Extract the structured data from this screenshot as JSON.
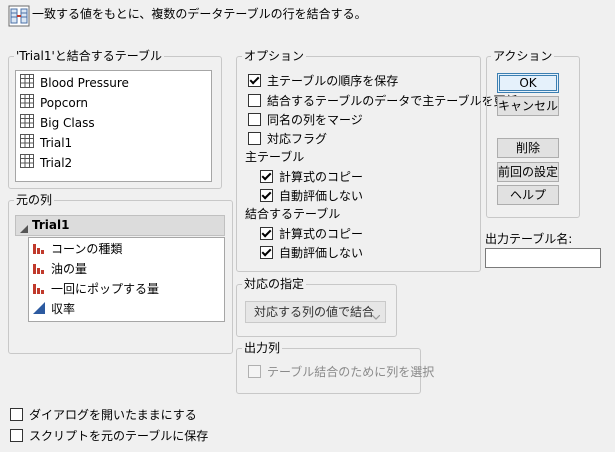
{
  "header": {
    "description": "一致する値をもとに、複数のデータテーブルの行を結合する。",
    "icon": "join-tables-icon"
  },
  "join_with": {
    "title": "'Trial1'と結合するテーブル",
    "items": [
      "Blood Pressure",
      "Popcorn",
      "Big Class",
      "Trial1",
      "Trial2"
    ]
  },
  "source_columns": {
    "title": "元の列",
    "table_name": "Trial1",
    "columns": [
      {
        "label": "コーンの種類",
        "icon": "nominal-bar-icon"
      },
      {
        "label": "油の量",
        "icon": "nominal-bar-icon"
      },
      {
        "label": "一回にポップする量",
        "icon": "nominal-bar-icon"
      },
      {
        "label": "収率",
        "icon": "continuous-triangle-icon"
      }
    ]
  },
  "options": {
    "title": "オプション",
    "preserve_order": {
      "label": "主テーブルの順序を保存",
      "checked": true
    },
    "update_main": {
      "label": "結合するテーブルのデータで主テーブルを更新",
      "checked": false
    },
    "merge_same_name": {
      "label": "同名の列をマージ",
      "checked": false
    },
    "match_flag": {
      "label": "対応フラグ",
      "checked": false
    },
    "main_table_label": "主テーブル",
    "main_copy_formula": {
      "label": "計算式のコピー",
      "checked": true
    },
    "main_suppress_eval": {
      "label": "自動評価しない",
      "checked": true
    },
    "joined_table_label": "結合するテーブル",
    "joined_copy_formula": {
      "label": "計算式のコピー",
      "checked": true
    },
    "joined_suppress_eval": {
      "label": "自動評価しない",
      "checked": true
    }
  },
  "matching": {
    "title": "対応の指定",
    "selected": "対応する列の値で結合"
  },
  "output_columns": {
    "title": "出力列",
    "select_label": "テーブル結合のために列を選択"
  },
  "actions": {
    "title": "アクション",
    "ok": "OK",
    "cancel": "キャンセル",
    "remove": "削除",
    "recall": "前回の設定",
    "help": "ヘルプ"
  },
  "output_table": {
    "label": "出力テーブル名:",
    "value": ""
  },
  "footer": {
    "keep_dialog_open": {
      "label": "ダイアログを開いたままにする",
      "checked": false
    },
    "save_script": {
      "label": "スクリプトを元のテーブルに保存",
      "checked": false
    }
  }
}
